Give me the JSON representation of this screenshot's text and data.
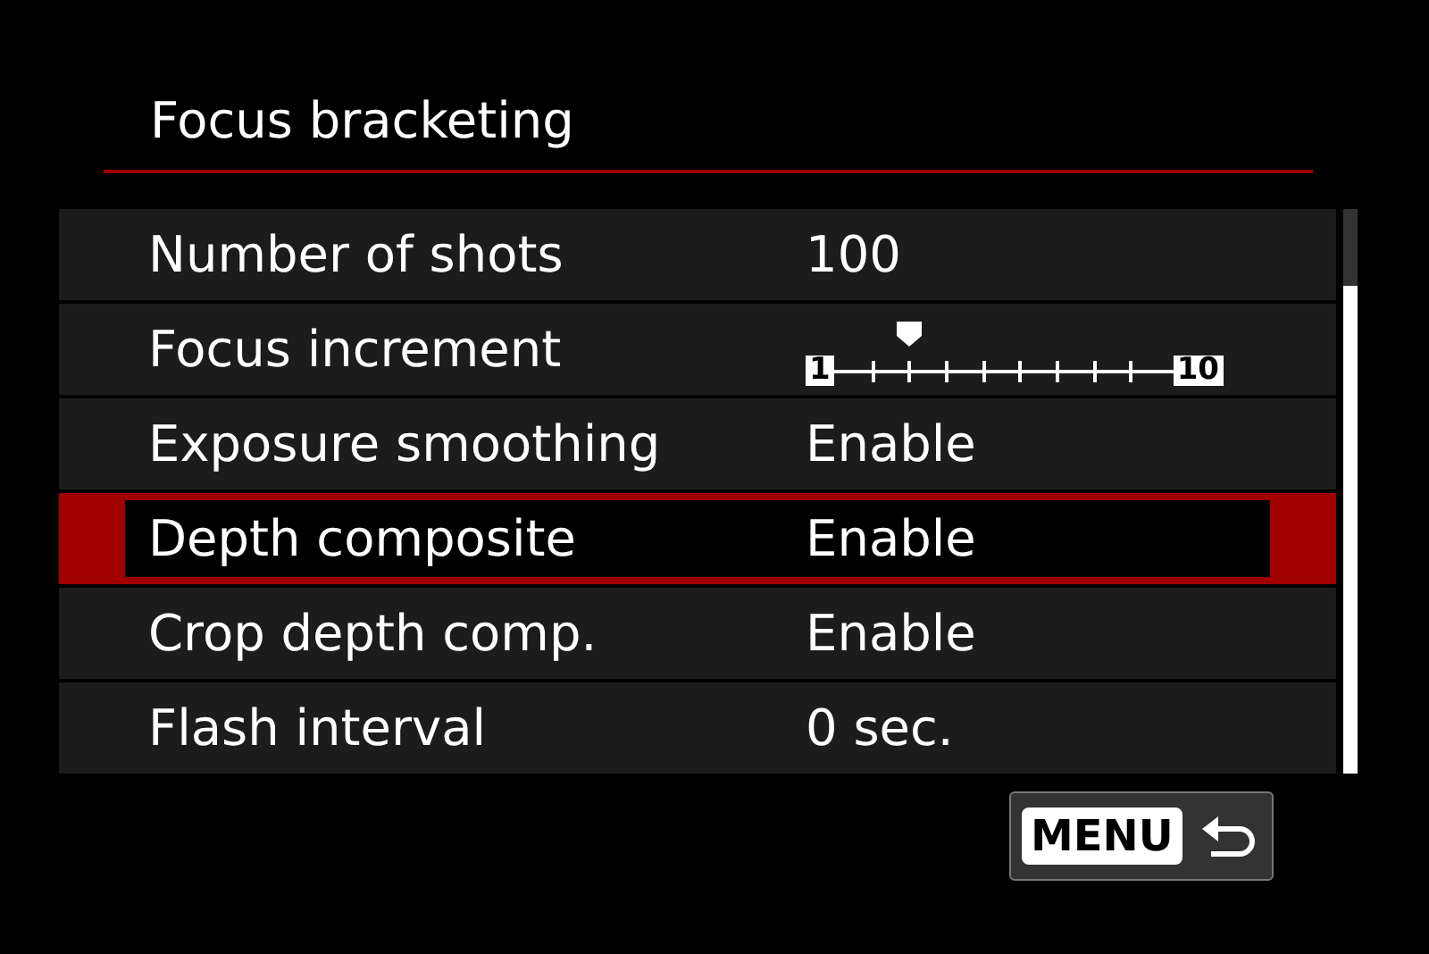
{
  "title": "Focus bracketing",
  "rows": [
    {
      "kind": "value",
      "label": "Number of shots",
      "value": "100",
      "selected": false
    },
    {
      "kind": "slider",
      "label": "Focus increment",
      "min": "1",
      "max": "10",
      "level": 0.222,
      "selected": false
    },
    {
      "kind": "value",
      "label": "Exposure smoothing",
      "value": "Enable",
      "selected": false
    },
    {
      "kind": "value",
      "label": "Depth composite",
      "value": "Enable",
      "selected": true
    },
    {
      "kind": "value",
      "label": "Crop depth comp.",
      "value": "Enable",
      "selected": false
    },
    {
      "kind": "value",
      "label": "Flash interval",
      "value": "0 sec.",
      "selected": false
    }
  ],
  "menu_button": {
    "label": "MENU"
  }
}
